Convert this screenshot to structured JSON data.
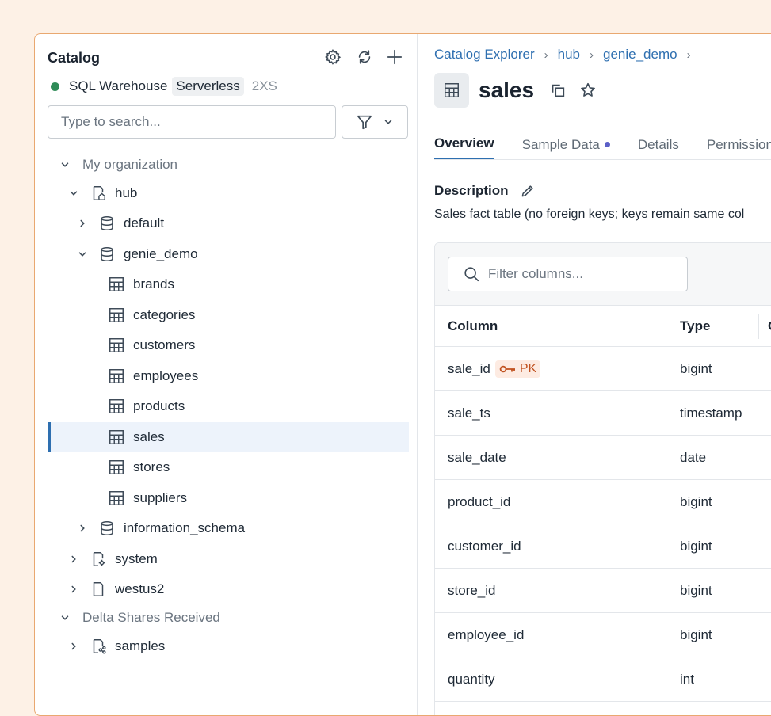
{
  "catalog": {
    "title": "Catalog",
    "icons": [
      "gear-icon",
      "refresh-icon",
      "plus-icon"
    ],
    "warehouse": {
      "name": "SQL Warehouse",
      "type": "Serverless",
      "size": "2XS",
      "status_color": "#2e8b57"
    },
    "search_placeholder": "Type to search...",
    "tree": {
      "my_org": "My organization",
      "hub": "hub",
      "default": "default",
      "genie_demo": "genie_demo",
      "tables": [
        "brands",
        "categories",
        "customers",
        "employees",
        "products",
        "sales",
        "stores",
        "suppliers"
      ],
      "information_schema": "information_schema",
      "system": "system",
      "westus2": "westus2",
      "delta_shares": "Delta Shares Received",
      "samples": "samples"
    }
  },
  "breadcrumb": [
    "Catalog Explorer",
    "hub",
    "genie_demo"
  ],
  "page_title": "sales",
  "tabs": [
    {
      "label": "Overview",
      "active": true
    },
    {
      "label": "Sample Data",
      "dot_color": "#5b5fc7"
    },
    {
      "label": "Details"
    },
    {
      "label": "Permissions"
    }
  ],
  "description": {
    "heading": "Description",
    "text": "Sales fact table (no foreign keys; keys remain same col"
  },
  "columns": {
    "filter_placeholder": "Filter columns...",
    "headers": [
      "Column",
      "Type",
      "C"
    ],
    "pk_label": "PK",
    "rows": [
      {
        "name": "sale_id",
        "type": "bigint"
      },
      {
        "name": "sale_ts",
        "type": "timestamp"
      },
      {
        "name": "sale_date",
        "type": "date"
      },
      {
        "name": "product_id",
        "type": "bigint"
      },
      {
        "name": "customer_id",
        "type": "bigint"
      },
      {
        "name": "store_id",
        "type": "bigint"
      },
      {
        "name": "employee_id",
        "type": "bigint"
      },
      {
        "name": "quantity",
        "type": "int"
      }
    ]
  },
  "colors": {
    "accent": "#2e6fb0",
    "pk": "#c0511f",
    "selected_bg": "#edf3fb"
  }
}
